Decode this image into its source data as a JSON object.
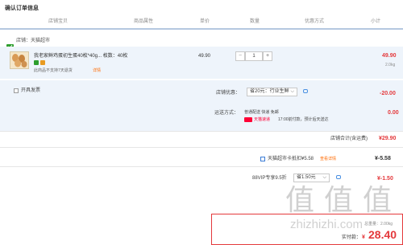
{
  "page": {
    "title": "确认订单信息"
  },
  "table_headers": [
    "店铺宝贝",
    "商品属性",
    "单价",
    "数量",
    "优惠方式",
    "小计"
  ],
  "shop": {
    "label": "店铺：天猫超市"
  },
  "product": {
    "name": "我老家鲜鸡蛋初生蛋40枚*40g...  枚数：40枚",
    "price": "49.90",
    "qty": "1",
    "minus": "−",
    "plus": "+",
    "subtotal": "49.90",
    "weight": "2.0kg",
    "return_note": "此商品不支持7天退货",
    "detail_link": "详情"
  },
  "invoice": {
    "label": "开具发票"
  },
  "shop_discount": {
    "label": "店铺优惠：",
    "select": "省20元：行业生鲜",
    "amount": "-20.00"
  },
  "shipping": {
    "label": "运送方式：",
    "method": "普通配送 快递 免邮",
    "amount": "0.00",
    "tmall_tag": "天猫速递",
    "delivery_note": "17:00前付款，预计后天送达"
  },
  "shop_total": {
    "label": "店铺合计(含运费)",
    "value": "¥29.90"
  },
  "coupon": {
    "label": "天猫超市卡抵扣¥5.58",
    "link": "查看详情",
    "amount": "¥-5.58"
  },
  "vip": {
    "label": "88VIP专享9.5折",
    "select": "省1.50元",
    "amount": "¥-1.50"
  },
  "summary": {
    "weight": "总重量：2.00kg",
    "pay_label": "实付款：",
    "currency": "¥",
    "pay_amount": "28.40"
  },
  "watermark": {
    "text": "zhizhizhi.com",
    "glyph": "值"
  },
  "colors": {
    "accent": "#e4393c",
    "tmall_red": "#ff0036",
    "link": "#ff6a00",
    "blue": "#3a7bd5"
  }
}
